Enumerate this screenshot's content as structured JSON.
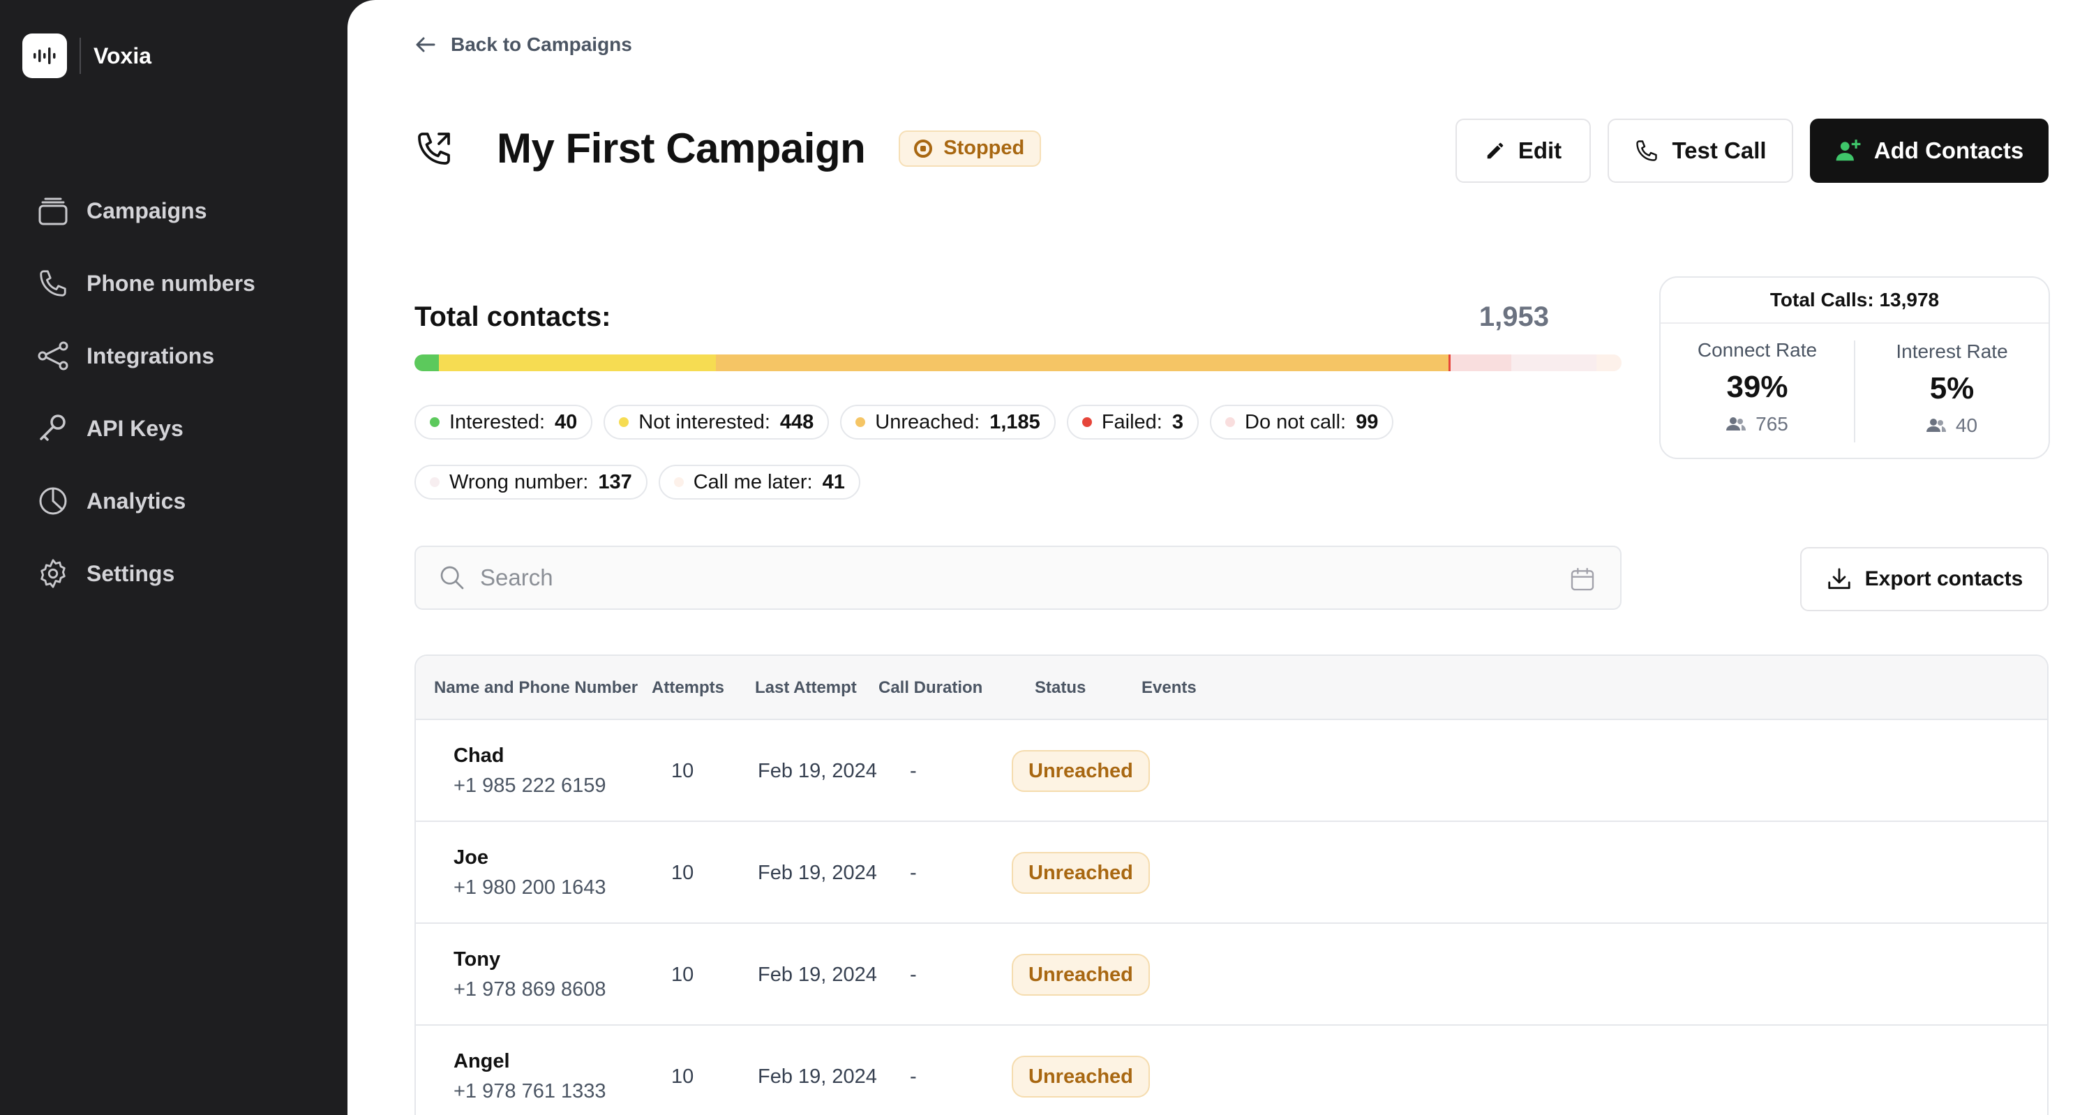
{
  "app": {
    "name": "Voxia"
  },
  "sidebar": {
    "items": [
      {
        "label": "Campaigns",
        "icon": "campaigns-icon"
      },
      {
        "label": "Phone numbers",
        "icon": "phone-icon"
      },
      {
        "label": "Integrations",
        "icon": "integrations-icon"
      },
      {
        "label": "API Keys",
        "icon": "key-icon"
      },
      {
        "label": "Analytics",
        "icon": "analytics-icon"
      },
      {
        "label": "Settings",
        "icon": "gear-icon"
      }
    ]
  },
  "header": {
    "back_label": "Back to Campaigns",
    "title": "My First Campaign",
    "status": "Stopped",
    "edit_label": "Edit",
    "test_call_label": "Test Call",
    "add_contacts_label": "Add Contacts"
  },
  "totals": {
    "label": "Total contacts:",
    "value": "1,953",
    "segments": [
      {
        "name": "Interested",
        "count": 40,
        "color": "#5cc95c"
      },
      {
        "name": "Not interested",
        "count": 448,
        "color": "#f6dc52"
      },
      {
        "name": "Unreached",
        "count": 1185,
        "color": "#f5c565"
      },
      {
        "name": "Failed",
        "count": 3,
        "color": "#e6453a"
      },
      {
        "name": "Do not call",
        "count": 99,
        "color": "#f9dede"
      },
      {
        "name": "Wrong number",
        "count": 137,
        "color": "#f9edee"
      },
      {
        "name": "Call me later",
        "count": 41,
        "color": "#fdf1ea"
      }
    ],
    "chips_row1": [
      {
        "label": "Interested:",
        "value": "40",
        "color": "#5cc95c"
      },
      {
        "label": "Not interested:",
        "value": "448",
        "color": "#f6dc52"
      },
      {
        "label": "Unreached:",
        "value": "1,185",
        "color": "#f5c565"
      },
      {
        "label": "Failed:",
        "value": "3",
        "color": "#e6453a"
      },
      {
        "label": "Do not call:",
        "value": "99",
        "color": "#f9dede"
      }
    ],
    "chips_row2": [
      {
        "label": "Wrong number:",
        "value": "137",
        "color": "#f7eef0"
      },
      {
        "label": "Call me later:",
        "value": "41",
        "color": "#fdf1ea"
      }
    ]
  },
  "stats": {
    "title": "Total Calls: 13,978",
    "connect": {
      "label": "Connect Rate",
      "value": "39%",
      "count": "765"
    },
    "interest": {
      "label": "Interest Rate",
      "value": "5%",
      "count": "40"
    }
  },
  "search": {
    "placeholder": "Search"
  },
  "export_label": "Export contacts",
  "table": {
    "columns": [
      "Name and Phone Number",
      "Attempts",
      "Last Attempt",
      "Call Duration",
      "Status",
      "Events"
    ],
    "rows": [
      {
        "name": "Chad",
        "phone": "+1 985 222 6159",
        "attempts": "10",
        "last": "Feb 19, 2024",
        "duration": "-",
        "status": "Unreached",
        "events": ""
      },
      {
        "name": "Joe",
        "phone": "+1 980 200 1643",
        "attempts": "10",
        "last": "Feb 19, 2024",
        "duration": "-",
        "status": "Unreached",
        "events": ""
      },
      {
        "name": "Tony",
        "phone": "+1 978 869 8608",
        "attempts": "10",
        "last": "Feb 19, 2024",
        "duration": "-",
        "status": "Unreached",
        "events": ""
      },
      {
        "name": "Angel",
        "phone": "+1 978 761 1333",
        "attempts": "10",
        "last": "Feb 19, 2024",
        "duration": "-",
        "status": "Unreached",
        "events": ""
      }
    ]
  }
}
